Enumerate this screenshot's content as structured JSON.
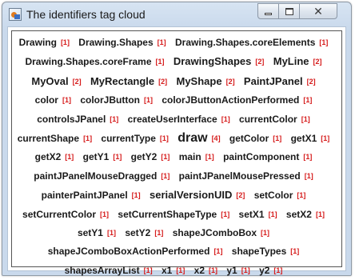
{
  "window": {
    "title": "The identifiers tag cloud",
    "close_glyph": "✕"
  },
  "tags": [
    {
      "name": "Drawing",
      "count": "[1]"
    },
    {
      "name": "Drawing.Shapes",
      "count": "[1]"
    },
    {
      "name": "Drawing.Shapes.coreElements",
      "count": "[1]"
    },
    {
      "name": "Drawing.Shapes.coreFrame",
      "count": "[1]"
    },
    {
      "name": "DrawingShapes",
      "count": "[2]"
    },
    {
      "name": "MyLine",
      "count": "[2]"
    },
    {
      "name": "MyOval",
      "count": "[2]"
    },
    {
      "name": "MyRectangle",
      "count": "[2]"
    },
    {
      "name": "MyShape",
      "count": "[2]"
    },
    {
      "name": "PaintJPanel",
      "count": "[2]"
    },
    {
      "name": "color",
      "count": "[1]"
    },
    {
      "name": "colorJButton",
      "count": "[1]"
    },
    {
      "name": "colorJButtonActionPerformed",
      "count": "[1]"
    },
    {
      "name": "controlsJPanel",
      "count": "[1]"
    },
    {
      "name": "createUserInterface",
      "count": "[1]"
    },
    {
      "name": "currentColor",
      "count": "[1]"
    },
    {
      "name": "currentShape",
      "count": "[1]"
    },
    {
      "name": "currentType",
      "count": "[1]"
    },
    {
      "name": "draw",
      "count": "[4]"
    },
    {
      "name": "getColor",
      "count": "[1]"
    },
    {
      "name": "getX1",
      "count": "[1]"
    },
    {
      "name": "getX2",
      "count": "[1]"
    },
    {
      "name": "getY1",
      "count": "[1]"
    },
    {
      "name": "getY2",
      "count": "[1]"
    },
    {
      "name": "main",
      "count": "[1]"
    },
    {
      "name": "paintComponent",
      "count": "[1]"
    },
    {
      "name": "paintJPanelMouseDragged",
      "count": "[1]"
    },
    {
      "name": "paintJPanelMousePressed",
      "count": "[1]"
    },
    {
      "name": "painterPaintJPanel",
      "count": "[1]"
    },
    {
      "name": "serialVersionUID",
      "count": "[2]"
    },
    {
      "name": "setColor",
      "count": "[1]"
    },
    {
      "name": "setCurrentColor",
      "count": "[1]"
    },
    {
      "name": "setCurrentShapeType",
      "count": "[1]"
    },
    {
      "name": "setX1",
      "count": "[1]"
    },
    {
      "name": "setX2",
      "count": "[1]"
    },
    {
      "name": "setY1",
      "count": "[1]"
    },
    {
      "name": "setY2",
      "count": "[1]"
    },
    {
      "name": "shapeJComboBox",
      "count": "[1]"
    },
    {
      "name": "shapeJComboBoxActionPerformed",
      "count": "[1]"
    },
    {
      "name": "shapeTypes",
      "count": "[1]"
    },
    {
      "name": "shapesArrayList",
      "count": "[1]"
    },
    {
      "name": "x1",
      "count": "[1]"
    },
    {
      "name": "x2",
      "count": "[1]"
    },
    {
      "name": "y1",
      "count": "[1]"
    },
    {
      "name": "y2",
      "count": "[1]"
    }
  ],
  "colors": {
    "tag_text": "#1a1a1a",
    "count_text": "#d61c1c",
    "window_frame": "#c9d9ec"
  }
}
